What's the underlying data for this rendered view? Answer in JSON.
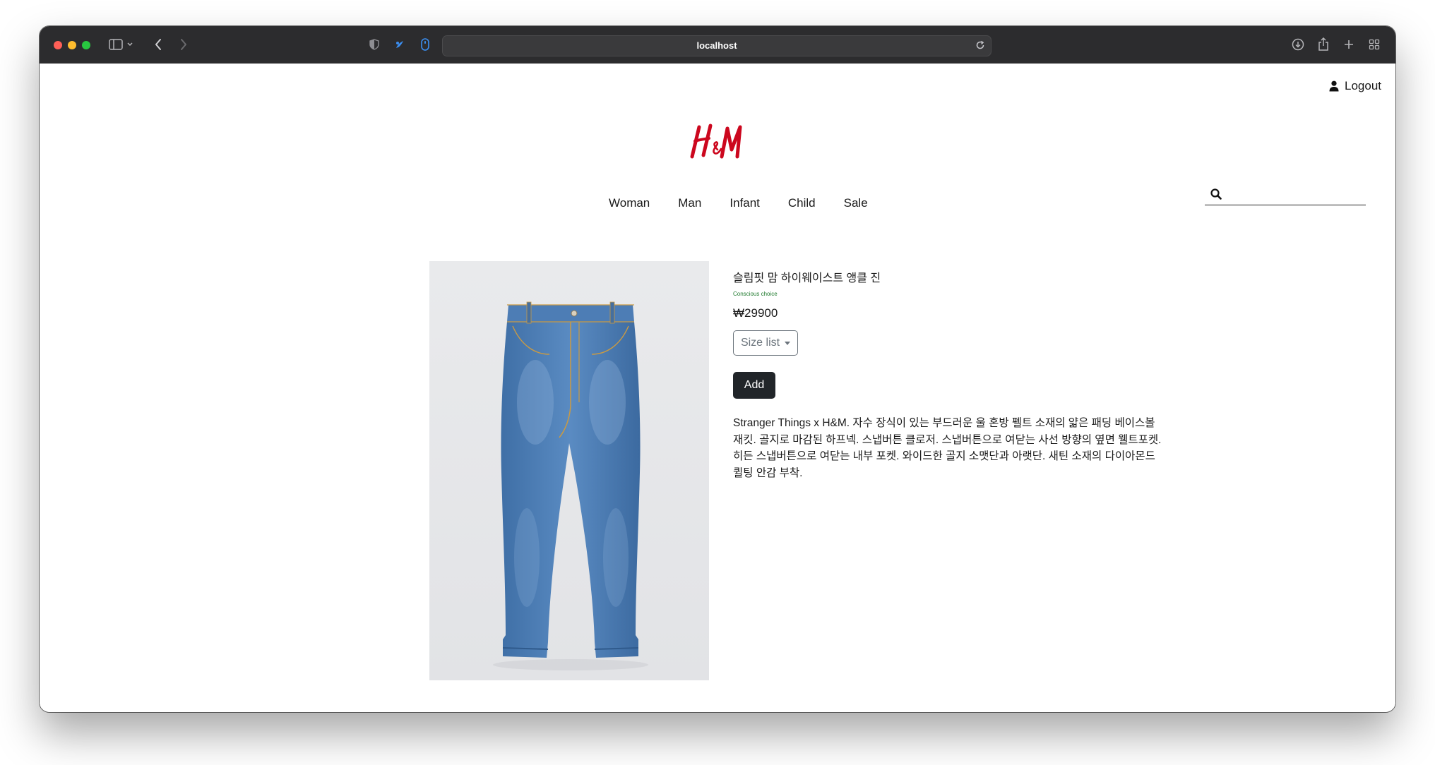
{
  "browser": {
    "url": "localhost"
  },
  "header": {
    "logout_label": "Logout",
    "logo_text": "H&M",
    "brand_color": "#cc071e"
  },
  "nav": {
    "items": [
      "Woman",
      "Man",
      "Infant",
      "Child",
      "Sale"
    ]
  },
  "search": {
    "value": "",
    "placeholder": ""
  },
  "product": {
    "title": "슬림핏 맘 하이웨이스트 앵클 진",
    "tag": "Conscious choice",
    "tag_color": "#1f7a2e",
    "price": "₩29900",
    "size_button_label": "Size list",
    "add_button_label": "Add",
    "description": "Stranger Things x H&M. 자수 장식이 있는 부드러운 울 혼방 펠트 소재의 얇은 패딩 베이스볼 재킷. 골지로 마감된 하프넥. 스냅버튼 클로저. 스냅버튼으로 여닫는 사선 방향의 옆면 웰트포켓. 히든 스냅버튼으로 여닫는 내부 포켓. 와이드한 골지 소맷단과 아랫단. 새틴 소재의 다이아몬드 퀼팅 안감 부착.",
    "image_alt": "blue-denim-mom-jeans"
  }
}
